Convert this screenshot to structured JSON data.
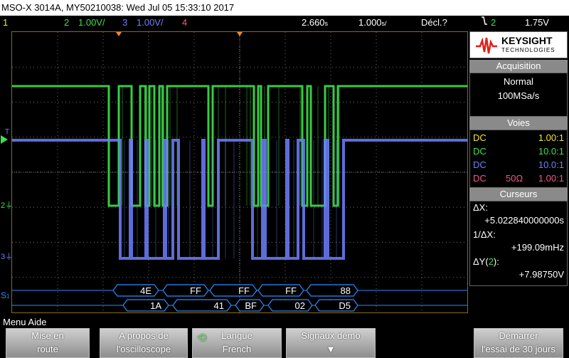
{
  "title": "MSO-X 3014A, MY50210038: Wed Jul 05 15:33:10 2017",
  "channel_bar": {
    "ch1_num": "1",
    "ch2_num": "2",
    "ch2_scale": "1.00V/",
    "ch3_num": "3",
    "ch3_scale": "1.00V/",
    "ch4_num": "4",
    "time_pos": "2.660",
    "time_pos_unit": "s",
    "time_scale": "1.000",
    "time_scale_unit": "s/",
    "mode": "Décl.?",
    "trig_icon": "trigger-edge-falling-icon",
    "trig_channel": "2",
    "trig_level": "1.75V"
  },
  "markers": {
    "trigger": "T",
    "ch2": "2",
    "ch3": "3",
    "s1": "S",
    "s1_sub": "1"
  },
  "decode": {
    "row1": [
      "4E",
      "FF",
      "FF",
      "FF",
      "88"
    ],
    "row2": [
      "1A",
      "41",
      "BF",
      "02",
      "D5"
    ]
  },
  "brand": {
    "name": "KEYSIGHT",
    "sub": "TECHNOLOGIES",
    "color": "#e0201b"
  },
  "acquisition": {
    "header": "Acquisition",
    "mode": "Normal",
    "rate": "100MSa/s"
  },
  "voies": {
    "header": "Voies",
    "rows": [
      {
        "coupling": "DC",
        "imp": "",
        "probe": "1.00:1",
        "color": "#f2e830"
      },
      {
        "coupling": "DC",
        "imp": "",
        "probe": "10.0:1",
        "color": "#3fe04a"
      },
      {
        "coupling": "DC",
        "imp": "",
        "probe": "10.0:1",
        "color": "#6f7fff"
      },
      {
        "coupling": "DC",
        "imp": "50Ω",
        "probe": "1.00:1",
        "color": "#f05a8a"
      }
    ]
  },
  "cursors": {
    "header": "Curseurs",
    "dx_label": "ΔX:",
    "dx_value": "+5.022840000000s",
    "inv_label": "1/ΔX:",
    "inv_value": "+199.09mHz",
    "dy_label": "ΔY(",
    "dy_channel": "2",
    "dy_label_end": "):",
    "dy_value": "+7.98750V"
  },
  "menu": {
    "title": "Menu Aide",
    "keys": [
      {
        "l1": "Mise en",
        "l2": "route"
      },
      {
        "l1": "A propos de",
        "l2": "l'oscilloscope"
      },
      {
        "l1": "Langue",
        "l2": "French"
      },
      {
        "l1": "Signaux démo",
        "l2": ""
      },
      {
        "l1": "Démarrer",
        "l2": "l'essai de 30 jours"
      }
    ]
  },
  "colors": {
    "ch1": "#f2e830",
    "ch2": "#3fe04a",
    "ch3": "#6f7fff",
    "ch4": "#f05a8a",
    "bus": "#2a8cff",
    "cursor": "#f08a2a",
    "grid": "#6b6b6b"
  }
}
